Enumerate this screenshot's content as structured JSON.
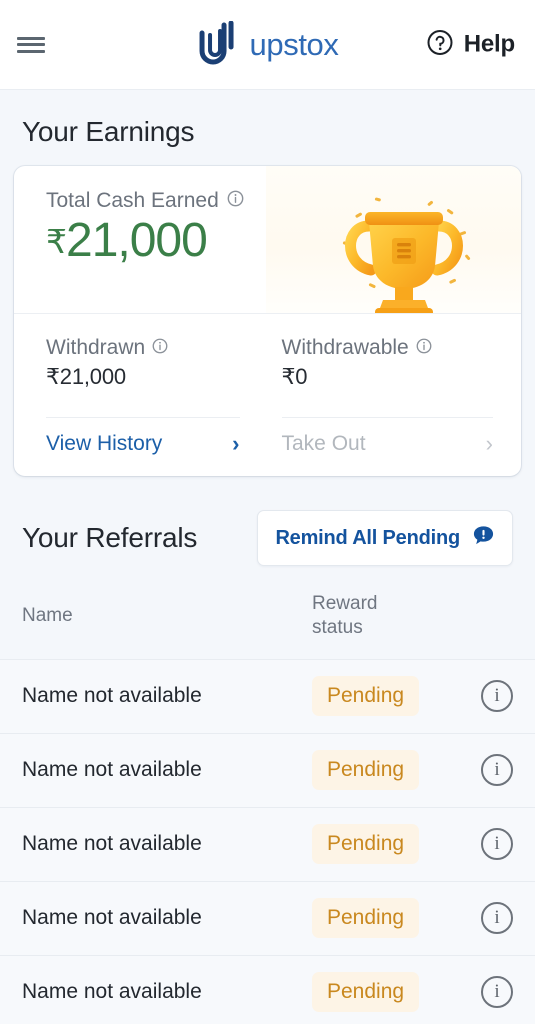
{
  "appbar": {
    "menu_icon": "hamburger-menu-icon",
    "brand_name": "upstox",
    "brand_logo_icon": "upstox-logo-icon",
    "help_icon": "help-circle-icon",
    "help_label": "Help"
  },
  "earnings": {
    "title": "Your Earnings",
    "total_label": "Total Cash Earned",
    "total_info_icon": "info-icon",
    "currency": "₹",
    "total_amount": "21,000",
    "trophy_icon": "trophy-icon",
    "withdrawn": {
      "label": "Withdrawn",
      "info_icon": "info-icon",
      "value": "₹21,000",
      "link_label": "View History",
      "link_chevron": "chevron-right-icon"
    },
    "withdrawable": {
      "label": "Withdrawable",
      "info_icon": "info-icon",
      "value": "₹0",
      "link_label": "Take Out",
      "link_chevron": "chevron-right-icon"
    }
  },
  "referrals": {
    "title": "Your Referrals",
    "remind_button_label": "Remind All Pending",
    "remind_button_icon": "speech-bubble-alert-icon",
    "columns": {
      "name": "Name",
      "reward_line1": "Reward",
      "reward_line2": "status"
    },
    "rows": [
      {
        "name": "Name not available",
        "status": "Pending",
        "info_icon": "info-icon"
      },
      {
        "name": "Name not available",
        "status": "Pending",
        "info_icon": "info-icon"
      },
      {
        "name": "Name not available",
        "status": "Pending",
        "info_icon": "info-icon"
      },
      {
        "name": "Name not available",
        "status": "Pending",
        "info_icon": "info-icon"
      },
      {
        "name": "Name not available",
        "status": "Pending",
        "info_icon": "info-icon"
      }
    ]
  },
  "colors": {
    "page_bg": "#f4f7fb",
    "brand_blue": "#2f6ab5",
    "brand_navy": "#1b3f74",
    "link_blue": "#1c5fa8",
    "amount_green": "#3b7f48",
    "badge_bg": "#fdf4e6",
    "badge_text": "#c9881f",
    "muted_text": "#6c737d",
    "disabled_text": "#b2b7bd"
  }
}
